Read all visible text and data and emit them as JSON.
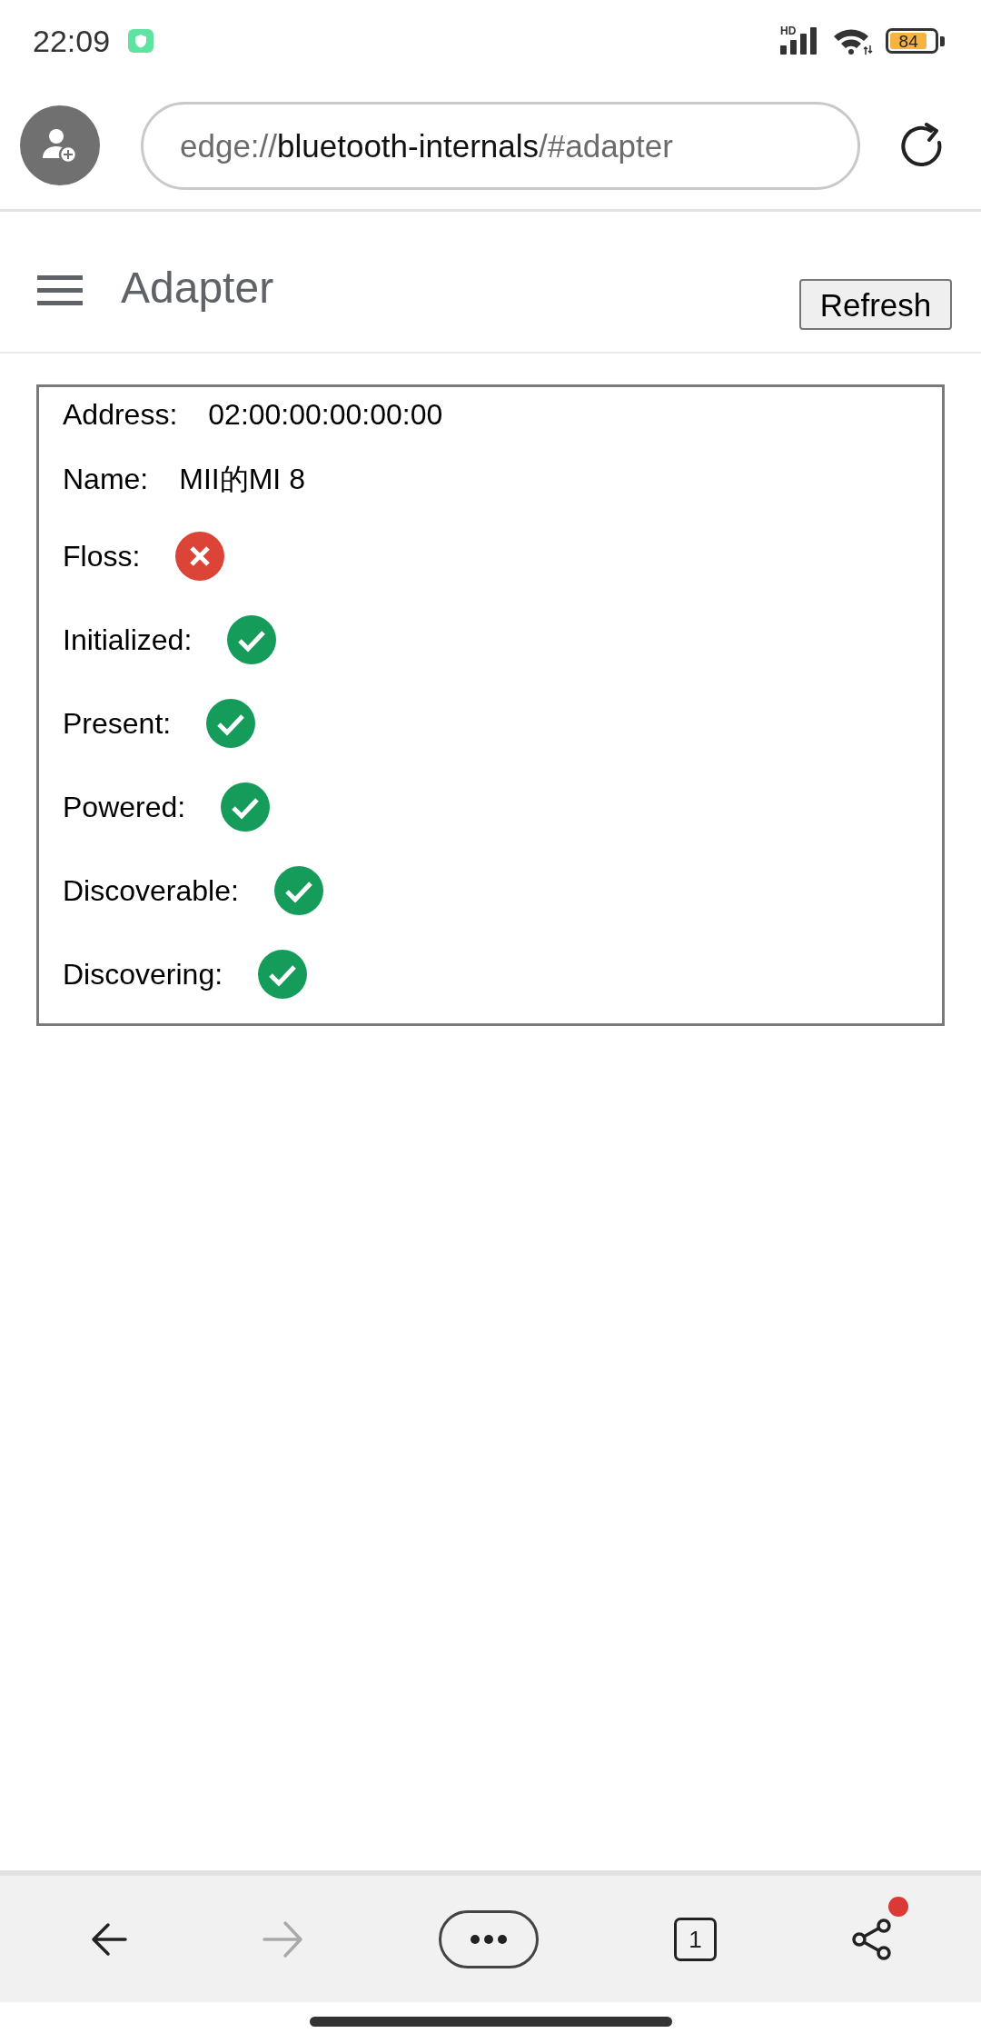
{
  "status_bar": {
    "time": "22:09",
    "network_type": "HD",
    "battery": "84"
  },
  "address_bar": {
    "url_scheme": "edge://",
    "url_host": "bluetooth-internals",
    "url_path": "/#adapter"
  },
  "page_header": {
    "title": "Adapter",
    "refresh_button": "Refresh"
  },
  "adapter": {
    "fields": [
      {
        "kind": "text",
        "label": "Address:",
        "value": "02:00:00:00:00:00"
      },
      {
        "kind": "text",
        "label": "Name:",
        "value": "MII的MI 8"
      },
      {
        "kind": "status",
        "label": "Floss:",
        "on": false
      },
      {
        "kind": "status",
        "label": "Initialized:",
        "on": true
      },
      {
        "kind": "status",
        "label": "Present:",
        "on": true
      },
      {
        "kind": "status",
        "label": "Powered:",
        "on": true
      },
      {
        "kind": "status",
        "label": "Discoverable:",
        "on": true
      },
      {
        "kind": "status",
        "label": "Discovering:",
        "on": true
      }
    ]
  },
  "bottom_bar": {
    "buttons": [
      {
        "kind": "back",
        "disabled": false
      },
      {
        "kind": "forward",
        "disabled": true
      },
      {
        "kind": "more",
        "disabled": false
      },
      {
        "kind": "tabs",
        "count": "1",
        "disabled": false
      },
      {
        "kind": "share",
        "disabled": false,
        "badge": true
      }
    ]
  }
}
